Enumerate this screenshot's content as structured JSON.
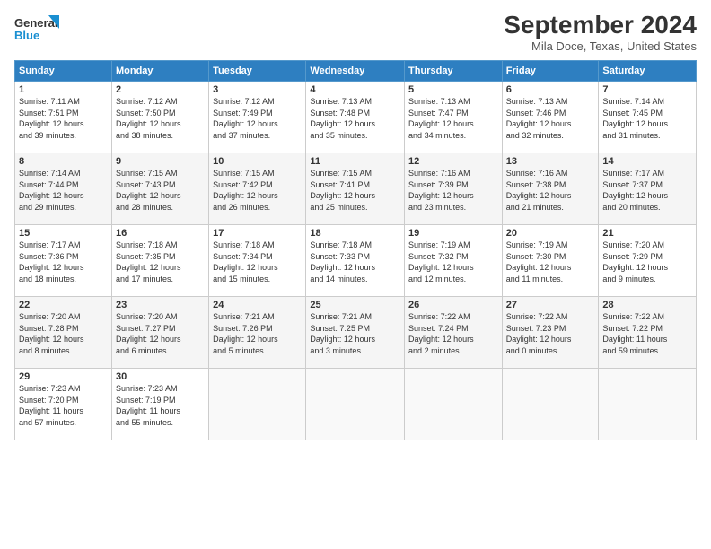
{
  "app": {
    "logo_general": "General",
    "logo_blue": "Blue"
  },
  "title": "September 2024",
  "subtitle": "Mila Doce, Texas, United States",
  "headers": [
    "Sunday",
    "Monday",
    "Tuesday",
    "Wednesday",
    "Thursday",
    "Friday",
    "Saturday"
  ],
  "weeks": [
    [
      {
        "day": "1",
        "info": "Sunrise: 7:11 AM\nSunset: 7:51 PM\nDaylight: 12 hours\nand 39 minutes."
      },
      {
        "day": "2",
        "info": "Sunrise: 7:12 AM\nSunset: 7:50 PM\nDaylight: 12 hours\nand 38 minutes."
      },
      {
        "day": "3",
        "info": "Sunrise: 7:12 AM\nSunset: 7:49 PM\nDaylight: 12 hours\nand 37 minutes."
      },
      {
        "day": "4",
        "info": "Sunrise: 7:13 AM\nSunset: 7:48 PM\nDaylight: 12 hours\nand 35 minutes."
      },
      {
        "day": "5",
        "info": "Sunrise: 7:13 AM\nSunset: 7:47 PM\nDaylight: 12 hours\nand 34 minutes."
      },
      {
        "day": "6",
        "info": "Sunrise: 7:13 AM\nSunset: 7:46 PM\nDaylight: 12 hours\nand 32 minutes."
      },
      {
        "day": "7",
        "info": "Sunrise: 7:14 AM\nSunset: 7:45 PM\nDaylight: 12 hours\nand 31 minutes."
      }
    ],
    [
      {
        "day": "8",
        "info": "Sunrise: 7:14 AM\nSunset: 7:44 PM\nDaylight: 12 hours\nand 29 minutes."
      },
      {
        "day": "9",
        "info": "Sunrise: 7:15 AM\nSunset: 7:43 PM\nDaylight: 12 hours\nand 28 minutes."
      },
      {
        "day": "10",
        "info": "Sunrise: 7:15 AM\nSunset: 7:42 PM\nDaylight: 12 hours\nand 26 minutes."
      },
      {
        "day": "11",
        "info": "Sunrise: 7:15 AM\nSunset: 7:41 PM\nDaylight: 12 hours\nand 25 minutes."
      },
      {
        "day": "12",
        "info": "Sunrise: 7:16 AM\nSunset: 7:39 PM\nDaylight: 12 hours\nand 23 minutes."
      },
      {
        "day": "13",
        "info": "Sunrise: 7:16 AM\nSunset: 7:38 PM\nDaylight: 12 hours\nand 21 minutes."
      },
      {
        "day": "14",
        "info": "Sunrise: 7:17 AM\nSunset: 7:37 PM\nDaylight: 12 hours\nand 20 minutes."
      }
    ],
    [
      {
        "day": "15",
        "info": "Sunrise: 7:17 AM\nSunset: 7:36 PM\nDaylight: 12 hours\nand 18 minutes."
      },
      {
        "day": "16",
        "info": "Sunrise: 7:18 AM\nSunset: 7:35 PM\nDaylight: 12 hours\nand 17 minutes."
      },
      {
        "day": "17",
        "info": "Sunrise: 7:18 AM\nSunset: 7:34 PM\nDaylight: 12 hours\nand 15 minutes."
      },
      {
        "day": "18",
        "info": "Sunrise: 7:18 AM\nSunset: 7:33 PM\nDaylight: 12 hours\nand 14 minutes."
      },
      {
        "day": "19",
        "info": "Sunrise: 7:19 AM\nSunset: 7:32 PM\nDaylight: 12 hours\nand 12 minutes."
      },
      {
        "day": "20",
        "info": "Sunrise: 7:19 AM\nSunset: 7:30 PM\nDaylight: 12 hours\nand 11 minutes."
      },
      {
        "day": "21",
        "info": "Sunrise: 7:20 AM\nSunset: 7:29 PM\nDaylight: 12 hours\nand 9 minutes."
      }
    ],
    [
      {
        "day": "22",
        "info": "Sunrise: 7:20 AM\nSunset: 7:28 PM\nDaylight: 12 hours\nand 8 minutes."
      },
      {
        "day": "23",
        "info": "Sunrise: 7:20 AM\nSunset: 7:27 PM\nDaylight: 12 hours\nand 6 minutes."
      },
      {
        "day": "24",
        "info": "Sunrise: 7:21 AM\nSunset: 7:26 PM\nDaylight: 12 hours\nand 5 minutes."
      },
      {
        "day": "25",
        "info": "Sunrise: 7:21 AM\nSunset: 7:25 PM\nDaylight: 12 hours\nand 3 minutes."
      },
      {
        "day": "26",
        "info": "Sunrise: 7:22 AM\nSunset: 7:24 PM\nDaylight: 12 hours\nand 2 minutes."
      },
      {
        "day": "27",
        "info": "Sunrise: 7:22 AM\nSunset: 7:23 PM\nDaylight: 12 hours\nand 0 minutes."
      },
      {
        "day": "28",
        "info": "Sunrise: 7:22 AM\nSunset: 7:22 PM\nDaylight: 11 hours\nand 59 minutes."
      }
    ],
    [
      {
        "day": "29",
        "info": "Sunrise: 7:23 AM\nSunset: 7:20 PM\nDaylight: 11 hours\nand 57 minutes."
      },
      {
        "day": "30",
        "info": "Sunrise: 7:23 AM\nSunset: 7:19 PM\nDaylight: 11 hours\nand 55 minutes."
      },
      null,
      null,
      null,
      null,
      null
    ]
  ]
}
